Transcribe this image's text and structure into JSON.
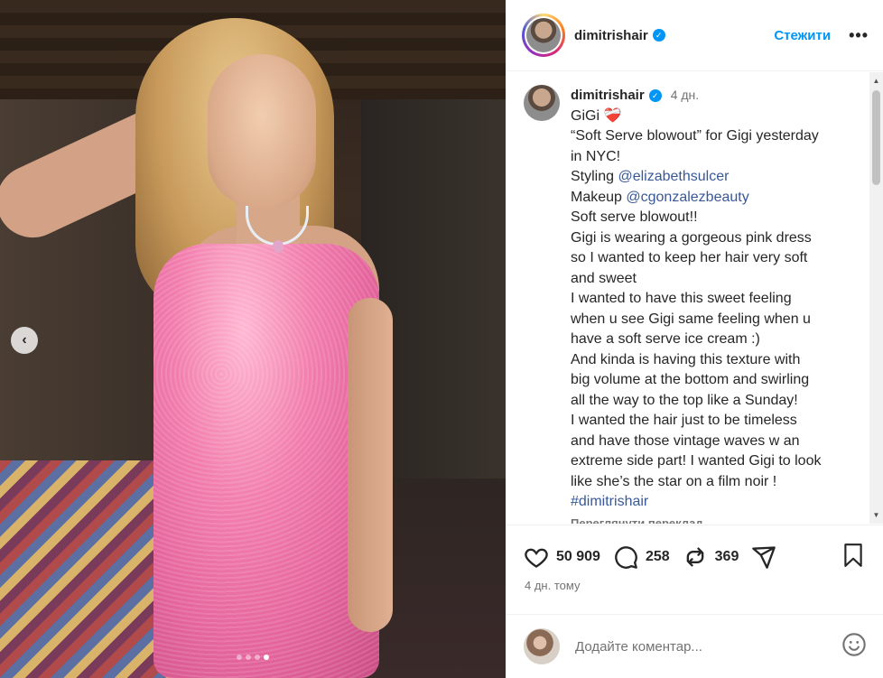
{
  "post": {
    "username": "dimitrishair",
    "follow_label": "Стежити",
    "more_label": "•••",
    "caption_time": "4 дн.",
    "caption_lines": [
      {
        "text": "GiGi ❤️‍🩹"
      },
      {
        "text": "“Soft Serve blowout” for Gigi yesterday"
      },
      {
        "text": "in NYC!"
      },
      {
        "prefix": "Styling ",
        "mention": "@elizabethsulcer"
      },
      {
        "prefix": "Makeup ",
        "mention": "@cgonzalezbeauty"
      },
      {
        "text": "Soft serve blowout!!"
      },
      {
        "text": "Gigi is wearing a gorgeous pink dress"
      },
      {
        "text": "so I wanted to keep her hair very soft"
      },
      {
        "text": "and sweet"
      },
      {
        "text": "I wanted to have this sweet feeling"
      },
      {
        "text": "when u see Gigi same feeling when u"
      },
      {
        "text": "have a soft serve ice cream :)"
      },
      {
        "text": "  And kinda is having this texture with"
      },
      {
        "text": "big volume at the bottom and swirling"
      },
      {
        "text": "all the way to the top like a Sunday!"
      },
      {
        "text": " I wanted the hair just to be timeless"
      },
      {
        "text": "and have those  vintage waves w an"
      },
      {
        "text": "extreme side part! I wanted Gigi to look"
      },
      {
        "text": "like she’s the star on a film noir !"
      },
      {
        "hashtag": "#dimitrishair"
      }
    ],
    "translate_label": "Переглянути переклад",
    "likes": "50 909",
    "comments": "258",
    "reposts": "369",
    "posted": "4 дн. тому",
    "comment_placeholder": "Додайте коментар...",
    "carousel": {
      "slides": 4,
      "active_index": 3
    }
  },
  "icons": {
    "like": "heart-icon",
    "comment": "comment-bubble-icon",
    "repost": "repost-icon",
    "share": "send-icon",
    "save": "bookmark-icon",
    "emoji": "smiley-icon",
    "prev": "chevron-left-icon",
    "verified": "verified-badge-icon"
  },
  "colors": {
    "accent": "#0095f6",
    "link": "#385898",
    "muted": "#737373"
  }
}
